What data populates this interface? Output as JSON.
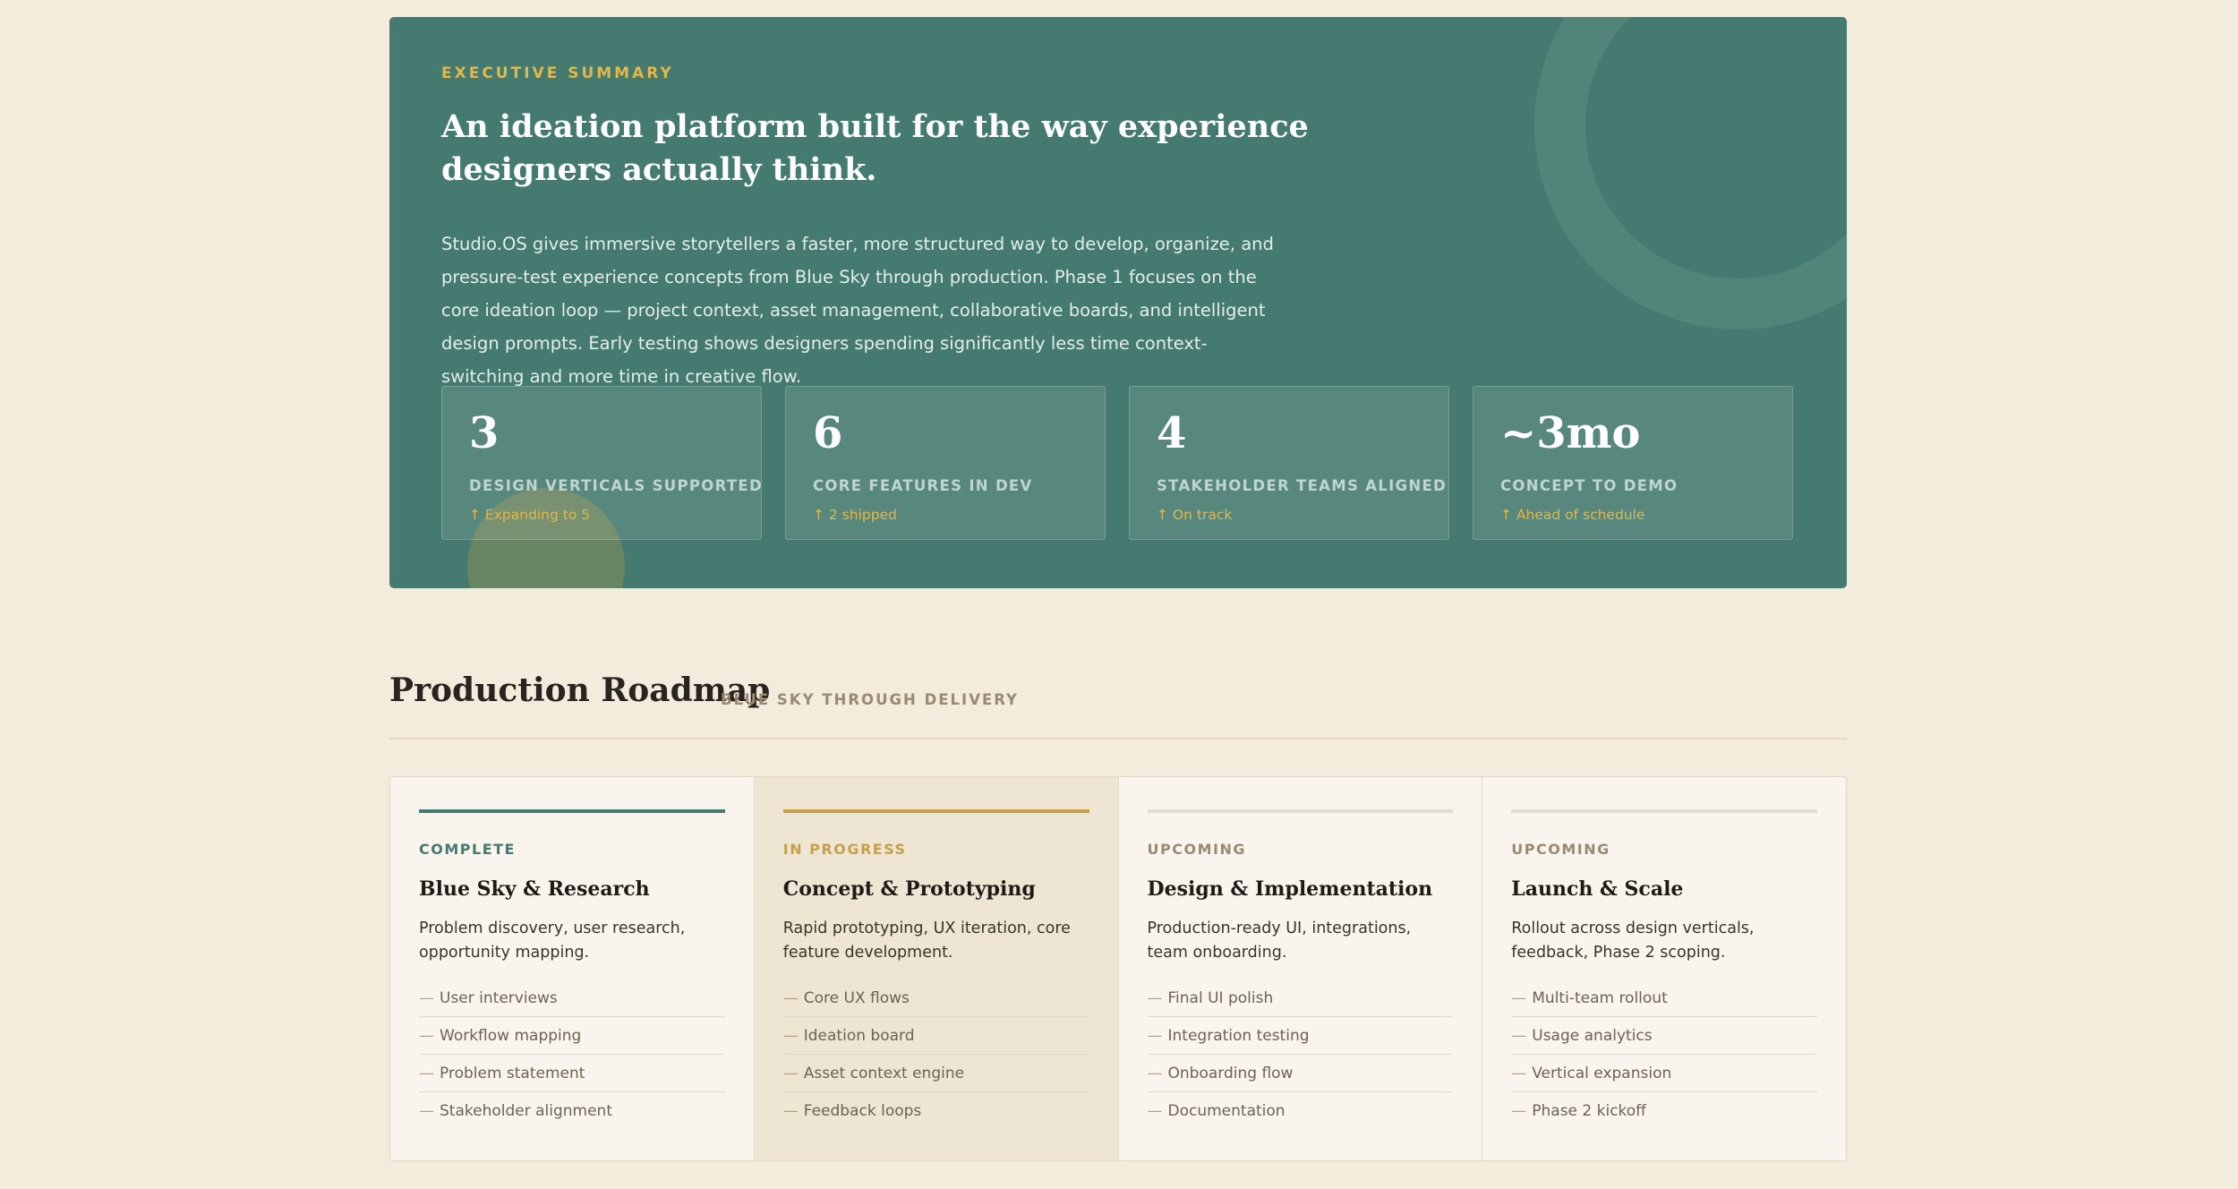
{
  "colors": {
    "page_bg": "#F3ECDD",
    "summary_bg": "#447A6F",
    "accent_gold": "#E3B84B",
    "complete": "#447A6F",
    "in_progress": "#C9A04A",
    "upcoming": "#E2DBD0"
  },
  "summary": {
    "eyebrow": "EXECUTIVE SUMMARY",
    "headline": "An ideation platform built for the way experience designers actually think.",
    "body": "Studio.OS gives immersive storytellers a faster, more structured way to develop, organize, and pressure-test experience concepts from Blue Sky through production. Phase 1 focuses on the core ideation loop — project context, asset management, collaborative boards, and intelligent design prompts. Early testing shows designers spending significantly less time context-switching and more time in creative flow.",
    "stats": [
      {
        "value": "3",
        "label": "DESIGN VERTICALS SUPPORTED",
        "delta": "↑ Expanding to 5"
      },
      {
        "value": "6",
        "label": "CORE FEATURES IN DEV",
        "delta": "↑ 2 shipped"
      },
      {
        "value": "4",
        "label": "STAKEHOLDER TEAMS ALIGNED",
        "delta": "↑ On track"
      },
      {
        "value": "~3mo",
        "label": "CONCEPT TO DEMO",
        "delta": "↑ Ahead of schedule"
      }
    ]
  },
  "roadmap": {
    "title": "Production Roadmap",
    "subtitle": "BLUE SKY THROUGH DELIVERY",
    "phases": [
      {
        "status": "COMPLETE",
        "title": "Blue Sky & Research",
        "description": "Problem discovery, user research, opportunity mapping.",
        "items": [
          "User interviews",
          "Workflow mapping",
          "Problem statement",
          "Stakeholder alignment"
        ]
      },
      {
        "status": "IN PROGRESS",
        "title": "Concept & Prototyping",
        "description": "Rapid prototyping, UX iteration, core feature development.",
        "items": [
          "Core UX flows",
          "Ideation board",
          "Asset context engine",
          "Feedback loops"
        ]
      },
      {
        "status": "UPCOMING",
        "title": "Design & Implementation",
        "description": "Production-ready UI, integrations, team onboarding.",
        "items": [
          "Final UI polish",
          "Integration testing",
          "Onboarding flow",
          "Documentation"
        ]
      },
      {
        "status": "UPCOMING",
        "title": "Launch & Scale",
        "description": "Rollout across design verticals, feedback, Phase 2 scoping.",
        "items": [
          "Multi-team rollout",
          "Usage analytics",
          "Vertical expansion",
          "Phase 2 kickoff"
        ]
      }
    ]
  }
}
